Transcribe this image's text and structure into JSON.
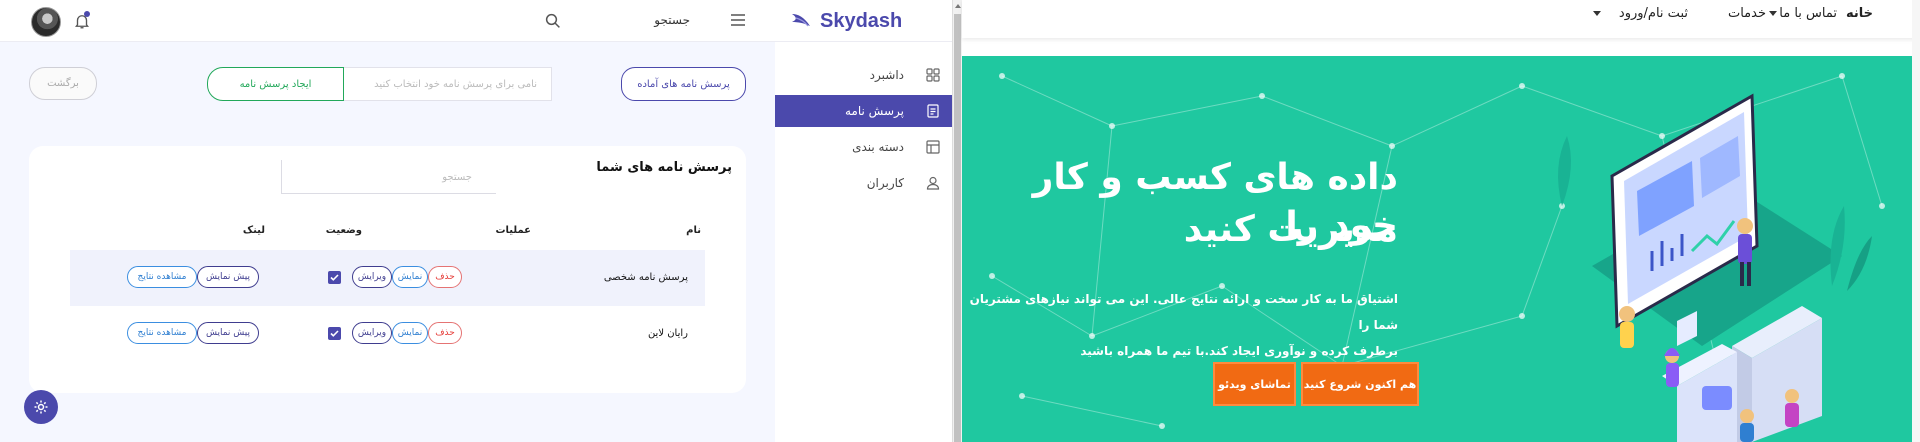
{
  "app": {
    "brand": "Skydash",
    "header": {
      "search_label": "جستجو"
    },
    "sidebar": {
      "items": [
        {
          "label": "داشبرد",
          "active": false
        },
        {
          "label": "پرسش نامه",
          "active": true
        },
        {
          "label": "دسته بندی",
          "active": false
        },
        {
          "label": "کاربران",
          "active": false
        }
      ]
    },
    "toolbar": {
      "ready_questionnaires_label": "پرسش نامه های آماده",
      "questionnaire_name_placeholder": "نامی برای پرسش نامه خود انتخاب کنید",
      "create_questionnaire_label": "ایجاد پرسش نامه",
      "back_label": "برگشت"
    },
    "card": {
      "title": "پرسش نامه های شما",
      "search_placeholder": "جستجو",
      "columns": [
        "نام",
        "عملیات",
        "وضعیت",
        "لینک"
      ],
      "rows": [
        {
          "name": "پرسش نامه شخصی",
          "delete": "حذف",
          "view": "نمایش",
          "edit": "ویرایش",
          "active": true,
          "preview": "پیش نمایش",
          "results": "مشاهده نتایج"
        },
        {
          "name": "رایان لاین",
          "delete": "حذف",
          "view": "نمایش",
          "edit": "ویرایش",
          "active": true,
          "preview": "پیش نمایش",
          "results": "مشاهده نتایج"
        }
      ]
    },
    "colors": {
      "accent": "#4b49ac",
      "success": "#22a85a",
      "danger": "#e53935",
      "info": "#2f7fd1"
    }
  },
  "site": {
    "nav": {
      "home": "خانه",
      "contact": "تماس با ما",
      "services": "خدمات",
      "signup_login": "ثبت نام/ورود"
    },
    "hero": {
      "title_line1": "داده های کسب و کار خود را",
      "title_line2": "مدیریت کنید",
      "desc_line1": "اشتیاق ما به کار سخت و ارائه نتایج عالی. این می تواند نیازهای مشتریان شما را",
      "desc_line2": "برطرف کرده و نوآوری ایجاد کند.با تیم ما همراه باشید",
      "start_button": "هم اکنون شروع کنید",
      "video_button": "تماشای ویدئو"
    },
    "colors": {
      "hero_bg": "#1fc8a0",
      "cta": "#f16a13"
    }
  }
}
